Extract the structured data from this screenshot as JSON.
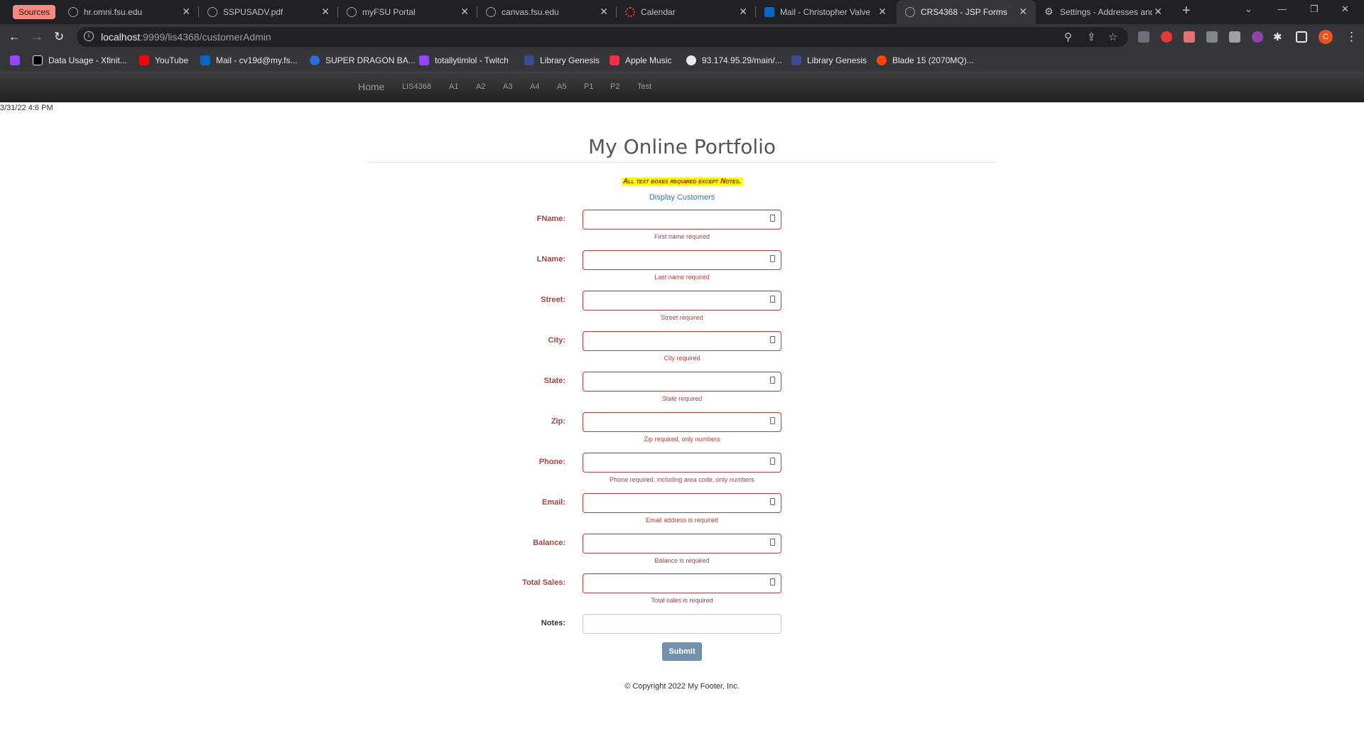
{
  "browser": {
    "sources_label": "Sources",
    "tabs": [
      {
        "title": "hr.omni.fsu.edu",
        "icon": "globe-icon"
      },
      {
        "title": "SSPUSADV.pdf",
        "icon": "globe-icon"
      },
      {
        "title": "myFSU Portal",
        "icon": "fsu-icon"
      },
      {
        "title": "canvas.fsu.edu",
        "icon": "globe-icon"
      },
      {
        "title": "Calendar",
        "icon": "calendar-icon"
      },
      {
        "title": "Mail - Christopher Valve",
        "icon": "outlook-icon"
      },
      {
        "title": "CRS4368 - JSP Forms",
        "icon": "globe-icon"
      },
      {
        "title": "Settings - Addresses and",
        "icon": "gear-icon"
      }
    ],
    "url_host": "localhost",
    "url_rest": ":9999/lis4368/customerAdmin",
    "profile_initial": "C",
    "bookmarks": [
      {
        "label": "",
        "color": "#9146ff"
      },
      {
        "label": "Data Usage - Xfinit...",
        "color": "#000000"
      },
      {
        "label": "YouTube",
        "color": "#ff0000"
      },
      {
        "label": "Mail - cv19d@my.fs...",
        "color": "#0a66c2"
      },
      {
        "label": "SUPER DRAGON BA...",
        "color": "#2b6cd8"
      },
      {
        "label": "totallytimlol - Twitch",
        "color": "#9146ff"
      },
      {
        "label": "Library Genesis",
        "color": "#3b4b8c"
      },
      {
        "label": "Apple Music",
        "color": "#fa2d48"
      },
      {
        "label": "93.174.95.29/main/...",
        "color": "#e8eaed"
      },
      {
        "label": "Library Genesis",
        "color": "#3b4b8c"
      },
      {
        "label": "Blade 15 (2070MQ)...",
        "color": "#ff4500"
      }
    ]
  },
  "site": {
    "nav": [
      "Home",
      "LIS4368",
      "A1",
      "A2",
      "A3",
      "A4",
      "A5",
      "P1",
      "P2",
      "Test"
    ],
    "datetime": "3/31/22 4:6 PM",
    "title": "My Online Portfolio",
    "notice": "All text boxes required except Notes.",
    "display_link": "Display Customers",
    "fields": [
      {
        "label": "FName:",
        "help": "First name required"
      },
      {
        "label": "LName:",
        "help": "Last name required"
      },
      {
        "label": "Street:",
        "help": "Street required"
      },
      {
        "label": "City:",
        "help": "City required"
      },
      {
        "label": "State:",
        "help": "State required"
      },
      {
        "label": "Zip:",
        "help": "Zip required, only numbers"
      },
      {
        "label": "Phone:",
        "help": "Phone required, including area code, only numbers"
      },
      {
        "label": "Email:",
        "help": "Email address is required"
      },
      {
        "label": "Balance:",
        "help": "Balance is required"
      },
      {
        "label": "Total Sales:",
        "help": "Total sales is required"
      }
    ],
    "notes_label": "Notes:",
    "submit_label": "Submit",
    "footer": "© Copyright 2022 My Footer, Inc."
  }
}
